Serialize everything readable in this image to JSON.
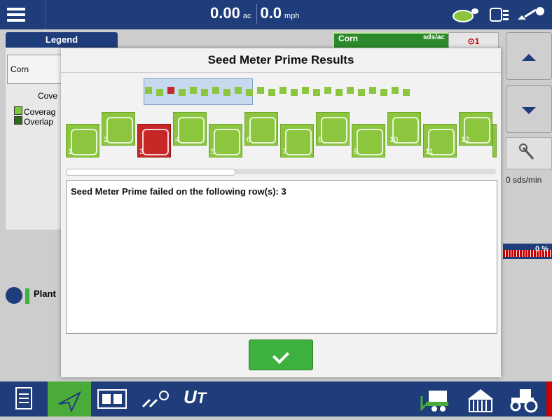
{
  "header": {
    "area_value": "0.00",
    "area_unit": "ac",
    "speed_value": "0.0",
    "speed_unit": "mph"
  },
  "legend": {
    "tab_label": "Legend",
    "product_button": "Corn",
    "coverage_heading": "Cove",
    "items": [
      {
        "label": "Coverag",
        "color": "#7cc93a"
      },
      {
        "label": "Overlap",
        "color": "#2e6b1c"
      }
    ]
  },
  "product_tab": {
    "crop": "Corn",
    "unit": "sds/ac"
  },
  "alert_count": "1",
  "side": {
    "rate": "0 sds/min",
    "percent": "0 %"
  },
  "plant_label": "Plant",
  "modal": {
    "title": "Seed Meter Prime Results",
    "message": "Seed Meter Prime failed on the following row(s): 3",
    "rows": [
      {
        "num": "1",
        "status": "ok"
      },
      {
        "num": "2",
        "status": "ok"
      },
      {
        "num": "3",
        "status": "failed"
      },
      {
        "num": "4",
        "status": "ok"
      },
      {
        "num": "5",
        "status": "ok"
      },
      {
        "num": "6",
        "status": "ok"
      },
      {
        "num": "7",
        "status": "ok"
      },
      {
        "num": "8",
        "status": "ok"
      },
      {
        "num": "9",
        "status": "ok"
      },
      {
        "num": "10",
        "status": "ok"
      },
      {
        "num": "11",
        "status": "ok"
      },
      {
        "num": "12",
        "status": "ok"
      }
    ],
    "colors": {
      "ok": "#8cc63f",
      "failed": "#c62828"
    }
  },
  "bottom_icons": [
    "document-icon",
    "navigation-arrow-icon",
    "split-view-icon",
    "seed-rows-icon",
    "ut-icon",
    "planter-icon",
    "grain-bin-icon",
    "tractor-icon"
  ]
}
